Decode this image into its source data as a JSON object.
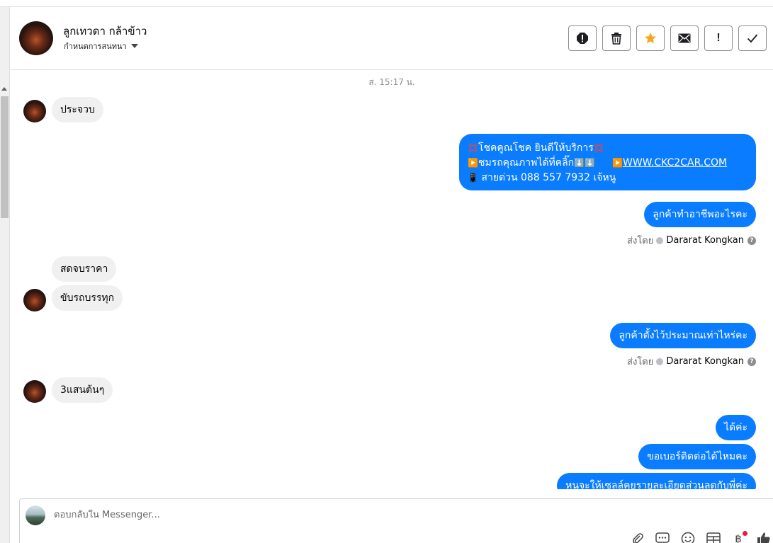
{
  "header": {
    "contact_name": "ลูกเทวดา กล้าข้าว",
    "assign_label": "กำหนดการสนทนา",
    "actions": [
      {
        "icon": "alert-circle-icon"
      },
      {
        "icon": "trash-icon"
      },
      {
        "icon": "star-icon",
        "color": "#f5a623"
      },
      {
        "icon": "envelope-icon"
      },
      {
        "icon": "exclamation-icon",
        "label": "!"
      },
      {
        "icon": "checkmark-icon"
      }
    ]
  },
  "conversation": {
    "timestamp": "ส. 15:17 น.",
    "messages": [
      {
        "from": "customer",
        "text": "ประจวบ"
      },
      {
        "from": "page",
        "lines": [
          "โชคคูณโชค ยินดีให้บริการ",
          "ชมรถคุณภาพได้ที่คลิ๊ก",
          "WWW.CKC2CAR.COM",
          "สายด่วน 088 557 7932 เจ้หนู"
        ]
      },
      {
        "from": "page",
        "text": "ลูกค้าทำอาชีพอะไรคะ"
      },
      {
        "from": "customer",
        "text": "สดจบราคา"
      },
      {
        "from": "customer",
        "text": "ขับรถบรรทุก"
      },
      {
        "from": "page",
        "text": "ลูกค้าตั้งไว้ประมาณเท่าไหร่คะ"
      },
      {
        "from": "customer",
        "text": "3แสนต้นๆ"
      },
      {
        "from": "page",
        "text": "ได้ค่ะ"
      },
      {
        "from": "page",
        "text": "ขอเบอร์ติดต่อได้ไหมคะ"
      },
      {
        "from": "page",
        "text": "หนูจะให้เซลล์คุยรายละเอียดส่วนลดกับพี่ค่ะ"
      }
    ],
    "sent_by_label": "ส่งโดย",
    "sent_by_name": "Dararat Kongkan"
  },
  "composer": {
    "placeholder": "ตอบกลับใน Messenger...",
    "tools": [
      "paperclip-icon",
      "saved-replies-icon",
      "emoji-icon",
      "template-icon",
      "baht-icon",
      "like-icon"
    ],
    "baht_symbol": "฿"
  },
  "colors": {
    "outgoing_bubble": "#0a7cff",
    "incoming_bubble": "#f0f0f0",
    "star": "#f5a623"
  }
}
